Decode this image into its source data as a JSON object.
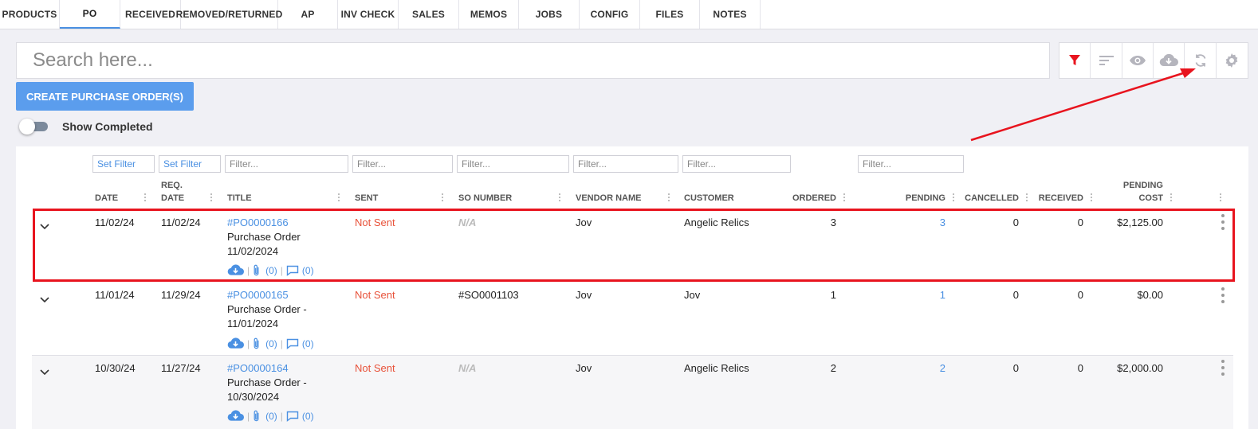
{
  "tabs": [
    {
      "label": "PRODUCTS"
    },
    {
      "label": "PO"
    },
    {
      "label": "RECEIVED"
    },
    {
      "label": "REMOVED/RETURNED"
    },
    {
      "label": "AP"
    },
    {
      "label": "INV CHECK"
    },
    {
      "label": "SALES"
    },
    {
      "label": "MEMOS"
    },
    {
      "label": "JOBS"
    },
    {
      "label": "CONFIG"
    },
    {
      "label": "FILES"
    },
    {
      "label": "NOTES"
    }
  ],
  "active_tab": "PO",
  "search": {
    "placeholder": "Search here...",
    "value": ""
  },
  "toolbar": {
    "icons": [
      "filter-icon",
      "sort-icon",
      "eye-icon",
      "cloud-download-icon",
      "refresh-icon",
      "gear-icon"
    ],
    "filter_color": "#e8141e",
    "icon_color": "#b5b5bd"
  },
  "create_button": "CREATE PURCHASE ORDER(S)",
  "show_completed": {
    "label": "Show Completed",
    "checked": false
  },
  "filters": {
    "date": "Set Filter",
    "req_date": "Set Filter",
    "title": "Filter...",
    "sent": "Filter...",
    "so_number": "Filter...",
    "vendor": "Filter...",
    "customer": "Filter...",
    "pending": "Filter..."
  },
  "columns": {
    "date": "DATE",
    "req_top": "REQ.",
    "req_bottom": "DATE",
    "title": "TITLE",
    "sent": "SENT",
    "so_number": "SO NUMBER",
    "vendor": "VENDOR NAME",
    "customer": "CUSTOMER",
    "ordered": "ORDERED",
    "pending": "PENDING",
    "cancelled": "CANCELLED",
    "received": "RECEIVED",
    "pending_cost_top": "PENDING",
    "pending_cost_bottom": "COST"
  },
  "rows": [
    {
      "date": "11/02/24",
      "req_date": "11/02/24",
      "po": "#PO0000166",
      "title_1": "Purchase Order",
      "title_2": "11/02/2024",
      "sent": "Not Sent",
      "so_number": "N/A",
      "vendor": "Jov",
      "customer": "Angelic Relics",
      "ordered": "3",
      "pending": "3",
      "cancelled": "0",
      "received": "0",
      "pending_cost": "$2,125.00",
      "attachments": "(0)",
      "comments": "(0)"
    },
    {
      "date": "11/01/24",
      "req_date": "11/29/24",
      "po": "#PO0000165",
      "title_1": "Purchase Order -",
      "title_2": "11/01/2024",
      "sent": "Not Sent",
      "so_number": "#SO0001103",
      "vendor": "Jov",
      "customer": "Jov",
      "ordered": "1",
      "pending": "1",
      "cancelled": "0",
      "received": "0",
      "pending_cost": "$0.00",
      "attachments": "(0)",
      "comments": "(0)"
    },
    {
      "date": "10/30/24",
      "req_date": "11/27/24",
      "po": "#PO0000164",
      "title_1": "Purchase Order -",
      "title_2": "10/30/2024",
      "sent": "Not Sent",
      "so_number": "N/A",
      "vendor": "Jov",
      "customer": "Angelic Relics",
      "ordered": "2",
      "pending": "2",
      "cancelled": "0",
      "received": "0",
      "pending_cost": "$2,000.00",
      "attachments": "(0)",
      "comments": "(0)"
    }
  ],
  "annotation_color": "#e8141e"
}
